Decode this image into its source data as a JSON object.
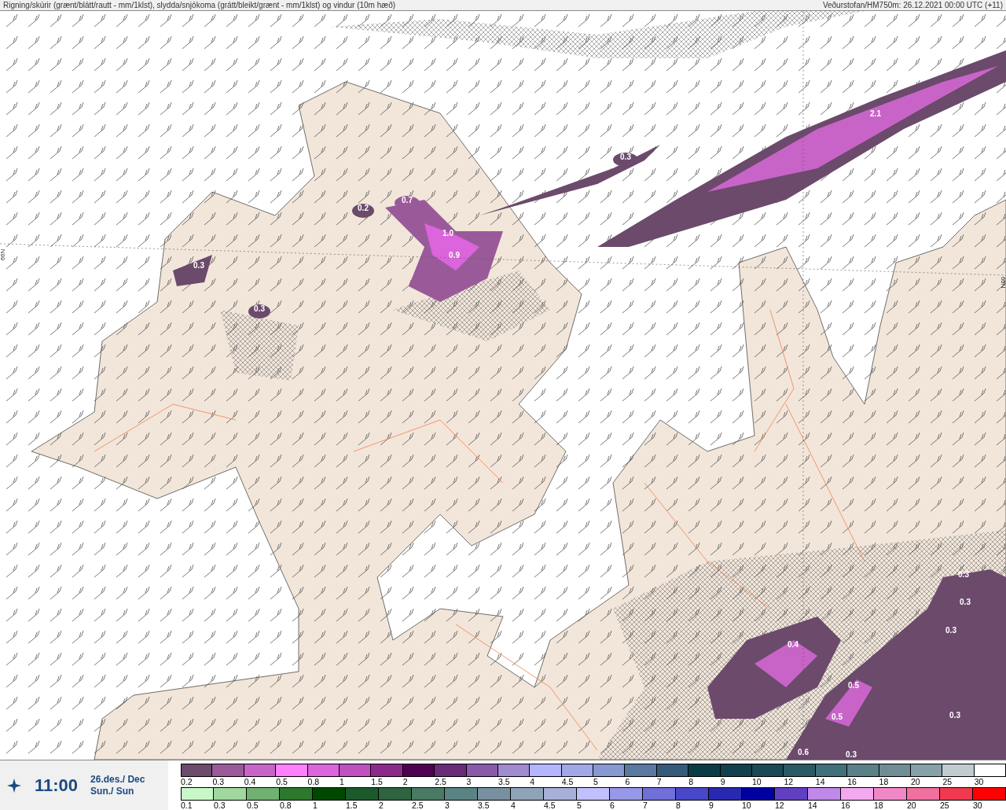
{
  "header": {
    "title": "Rigning/skúrir (grænt/blátt/rautt - mm/1klst), slydda/snjókoma (grátt/bleikt/grænt - mm/1klst) og vindur (10m hæð)",
    "source": "Veðurstofan/HM750m: 26.12.2021 00:00 UTC (+11)"
  },
  "map": {
    "latitude_labels": [
      "66N",
      "66N"
    ],
    "value_labels": [
      "2.1",
      "0.3",
      "0.7",
      "0.2",
      "1.0",
      "0.9",
      "0.3",
      "0.3",
      "0.3",
      "0.3",
      "0.3",
      "0.4",
      "0.5",
      "0.5",
      "0.3",
      "0.6",
      "0.3"
    ]
  },
  "time_panel": {
    "time": "11:00",
    "date": "26.des./ Dec",
    "weekday": "Sun./ Sun"
  },
  "legend_rows": [
    [
      {
        "label": "0.2",
        "color": "#6b4a6b"
      },
      {
        "label": "0.3",
        "color": "#9a5a9a"
      },
      {
        "label": "0.4",
        "color": "#c864c8"
      },
      {
        "label": "0.5",
        "color": "#ff80ff"
      },
      {
        "label": "0.8",
        "color": "#dc64dc"
      },
      {
        "label": "1",
        "color": "#c050c0"
      },
      {
        "label": "1.5",
        "color": "#8c2a8c"
      },
      {
        "label": "2",
        "color": "#500050"
      },
      {
        "label": "2.5",
        "color": "#6a2a7a"
      },
      {
        "label": "3",
        "color": "#8a5aaa"
      },
      {
        "label": "3.5",
        "color": "#a08ad0"
      },
      {
        "label": "4",
        "color": "#b4b4ff"
      },
      {
        "label": "4.5",
        "color": "#a0a8e8"
      },
      {
        "label": "5",
        "color": "#8898d0"
      },
      {
        "label": "6",
        "color": "#5a78a0"
      },
      {
        "label": "7",
        "color": "#365a7a"
      },
      {
        "label": "8",
        "color": "#0a3c46"
      },
      {
        "label": "9",
        "color": "#12404c"
      },
      {
        "label": "10",
        "color": "#1a4a54"
      },
      {
        "label": "12",
        "color": "#2a5a64"
      },
      {
        "label": "14",
        "color": "#40707a"
      },
      {
        "label": "16",
        "color": "#5a8088"
      },
      {
        "label": "18",
        "color": "#708c94"
      },
      {
        "label": "20",
        "color": "#88a0a8"
      },
      {
        "label": "25",
        "color": "#c0ccd0"
      },
      {
        "label": "30",
        "color": "#ffffff"
      }
    ],
    [
      {
        "label": "0.1",
        "color": "#c8f8c8"
      },
      {
        "label": "0.3",
        "color": "#a0d8a0"
      },
      {
        "label": "0.5",
        "color": "#70b070"
      },
      {
        "label": "0.8",
        "color": "#2c782c"
      },
      {
        "label": "1",
        "color": "#004800"
      },
      {
        "label": "1.5",
        "color": "#1c5a2c"
      },
      {
        "label": "2",
        "color": "#2e6440"
      },
      {
        "label": "2.5",
        "color": "#4a7a64"
      },
      {
        "label": "3",
        "color": "#5a8484"
      },
      {
        "label": "3.5",
        "color": "#7890a0"
      },
      {
        "label": "4",
        "color": "#90a4b8"
      },
      {
        "label": "4.5",
        "color": "#a8b0d8"
      },
      {
        "label": "5",
        "color": "#c0c0ff"
      },
      {
        "label": "6",
        "color": "#9898e8"
      },
      {
        "label": "7",
        "color": "#7070d8"
      },
      {
        "label": "8",
        "color": "#4848c8"
      },
      {
        "label": "9",
        "color": "#2828b0"
      },
      {
        "label": "10",
        "color": "#0000a0"
      },
      {
        "label": "12",
        "color": "#6040c0"
      },
      {
        "label": "14",
        "color": "#c088e8"
      },
      {
        "label": "16",
        "color": "#f4a8f0"
      },
      {
        "label": "18",
        "color": "#f088c8"
      },
      {
        "label": "20",
        "color": "#f070a0"
      },
      {
        "label": "25",
        "color": "#f03850"
      },
      {
        "label": "30",
        "color": "#ff0000"
      }
    ]
  ]
}
